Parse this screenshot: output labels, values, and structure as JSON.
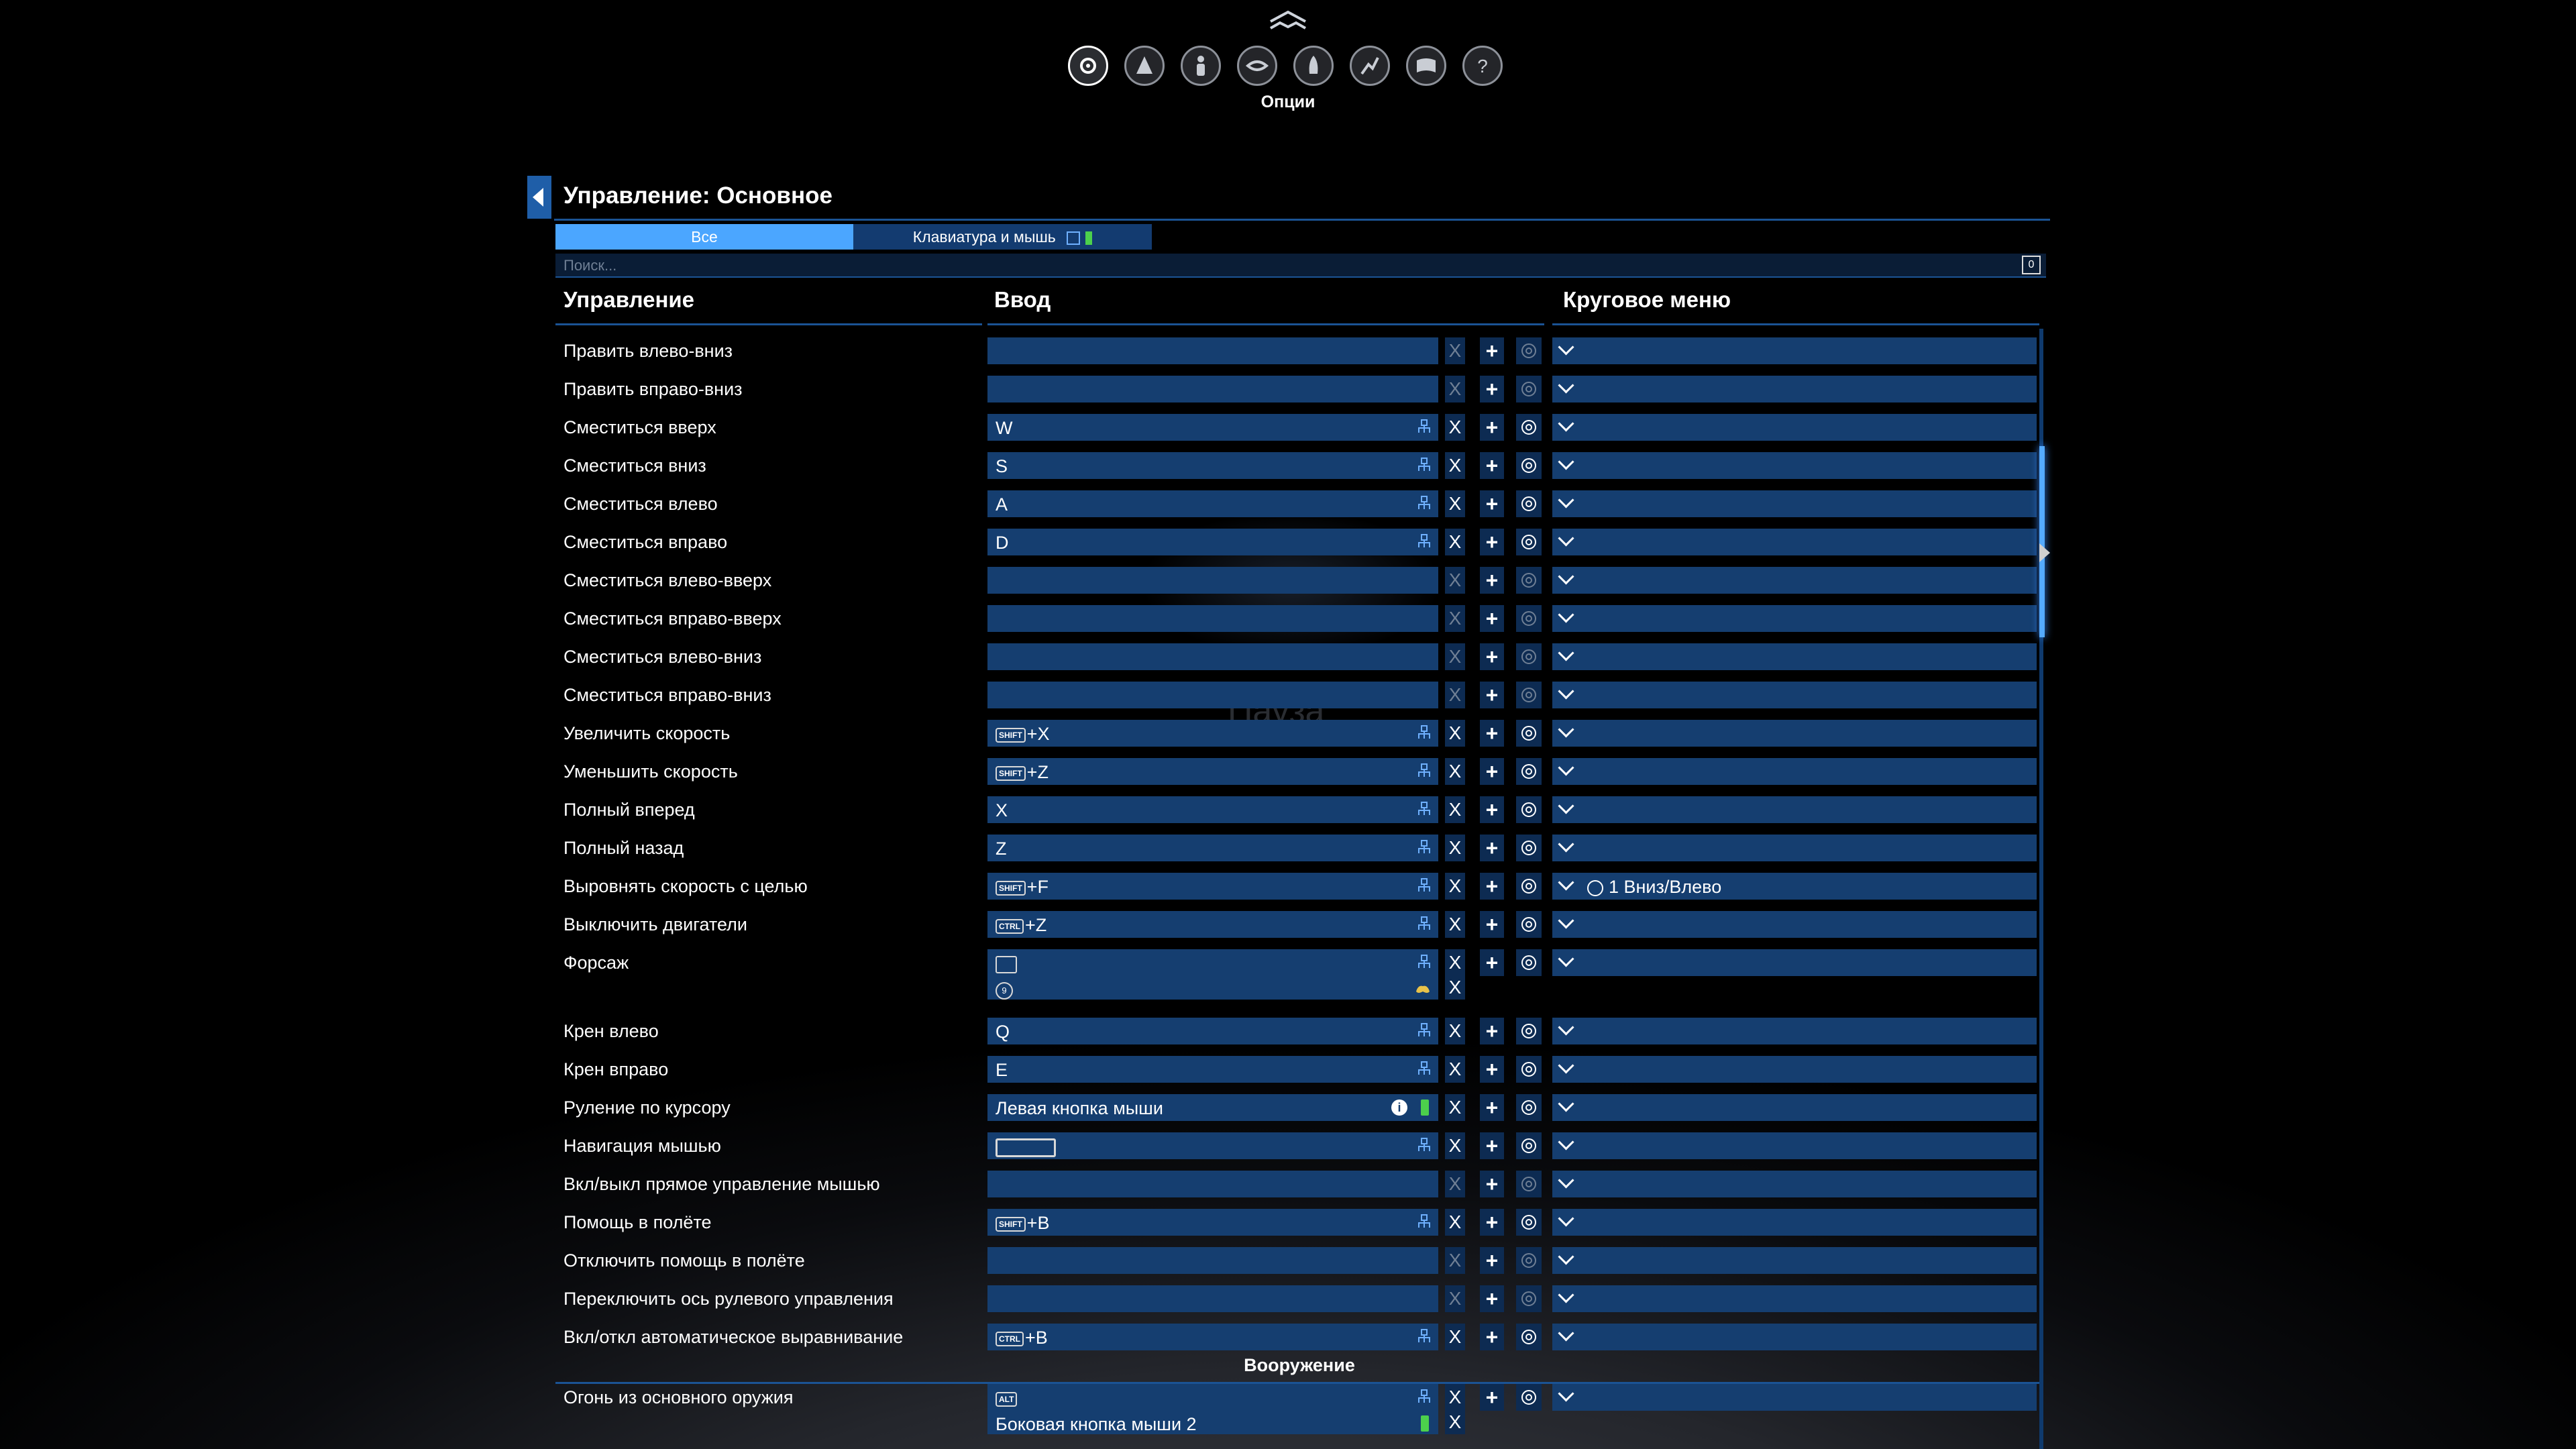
{
  "nav": {
    "icons": [
      "gear-icon",
      "ship-icon",
      "person-icon",
      "handshake-icon",
      "rocket-icon",
      "map-icon",
      "encyclopedia-icon",
      "help-icon"
    ],
    "active_label": "Опции"
  },
  "pause_text": "Пауза",
  "panel": {
    "title": "Управление: Основное",
    "tabs": [
      "Все",
      "Клавиатура и мышь"
    ],
    "search_placeholder": "Поиск...",
    "search_key": "0",
    "headers": {
      "action": "Управление",
      "input": "Ввод",
      "radial": "Круговое меню"
    }
  },
  "rows": [
    {
      "label": "Править влево-вниз",
      "key": "",
      "bound": false
    },
    {
      "label": "Править вправо-вниз",
      "key": "",
      "bound": false
    },
    {
      "label": "Сместиться вверх",
      "key": "W",
      "bound": true
    },
    {
      "label": "Сместиться вниз",
      "key": "S",
      "bound": true
    },
    {
      "label": "Сместиться влево",
      "key": "A",
      "bound": true
    },
    {
      "label": "Сместиться вправо",
      "key": "D",
      "bound": true
    },
    {
      "label": "Сместиться влево-вверх",
      "key": "",
      "bound": false
    },
    {
      "label": "Сместиться вправо-вверх",
      "key": "",
      "bound": false
    },
    {
      "label": "Сместиться влево-вниз",
      "key": "",
      "bound": false
    },
    {
      "label": "Сместиться вправо-вниз",
      "key": "",
      "bound": false
    },
    {
      "label": "Увеличить скорость",
      "mod": "SHIFT",
      "key": "+X",
      "bound": true
    },
    {
      "label": "Уменьшить скорость",
      "mod": "SHIFT",
      "key": "+Z",
      "bound": true
    },
    {
      "label": "Полный вперед",
      "key": "X",
      "bound": true
    },
    {
      "label": "Полный назад",
      "key": "Z",
      "bound": true
    },
    {
      "label": "Выровнять скорость с целью",
      "mod": "SHIFT",
      "key": "+F",
      "bound": true,
      "radial": "1  Вниз/Влево"
    },
    {
      "label": "Выключить двигатели",
      "mod": "CTRL",
      "key": "+Z",
      "bound": true
    },
    {
      "label": "Форсаж",
      "key": "",
      "bound": true,
      "special": "tab"
    },
    {
      "label": "",
      "key": "",
      "bound": true,
      "special": "second",
      "round": "9"
    },
    {
      "label": "Крен влево",
      "key": "Q",
      "bound": true
    },
    {
      "label": "Крен вправо",
      "key": "E",
      "bound": true
    },
    {
      "label": "Руление по курсору",
      "key": "Левая кнопка мыши",
      "bound": true,
      "special": "mouse"
    },
    {
      "label": "Навигация мышью",
      "key": "",
      "bound": true,
      "special": "space"
    },
    {
      "label": "Вкл/выкл прямое управление мышью",
      "key": "",
      "bound": false
    },
    {
      "label": "Помощь в полёте",
      "mod": "SHIFT",
      "key": "+B",
      "bound": true
    },
    {
      "label": "Отключить помощь в полёте",
      "key": "",
      "bound": false
    },
    {
      "label": "Переключить ось рулевого управления",
      "key": "",
      "bound": false
    },
    {
      "label": "Вкл/откл автоматическое выравнивание",
      "mod": "CTRL",
      "key": "+B",
      "bound": true
    }
  ],
  "section_title": "Вооружение",
  "weapon_rows": [
    {
      "label": "Огонь из основного оружия",
      "mod": "ALT",
      "key": "",
      "bound": true
    },
    {
      "label": "",
      "key": "Боковая кнопка мыши 2",
      "bound": true,
      "special": "mouse-second"
    }
  ],
  "colors": {
    "accent": "#4ba6ff",
    "field": "#153e70",
    "dark_field": "#0d2b52",
    "battery": "#4cd04c"
  }
}
